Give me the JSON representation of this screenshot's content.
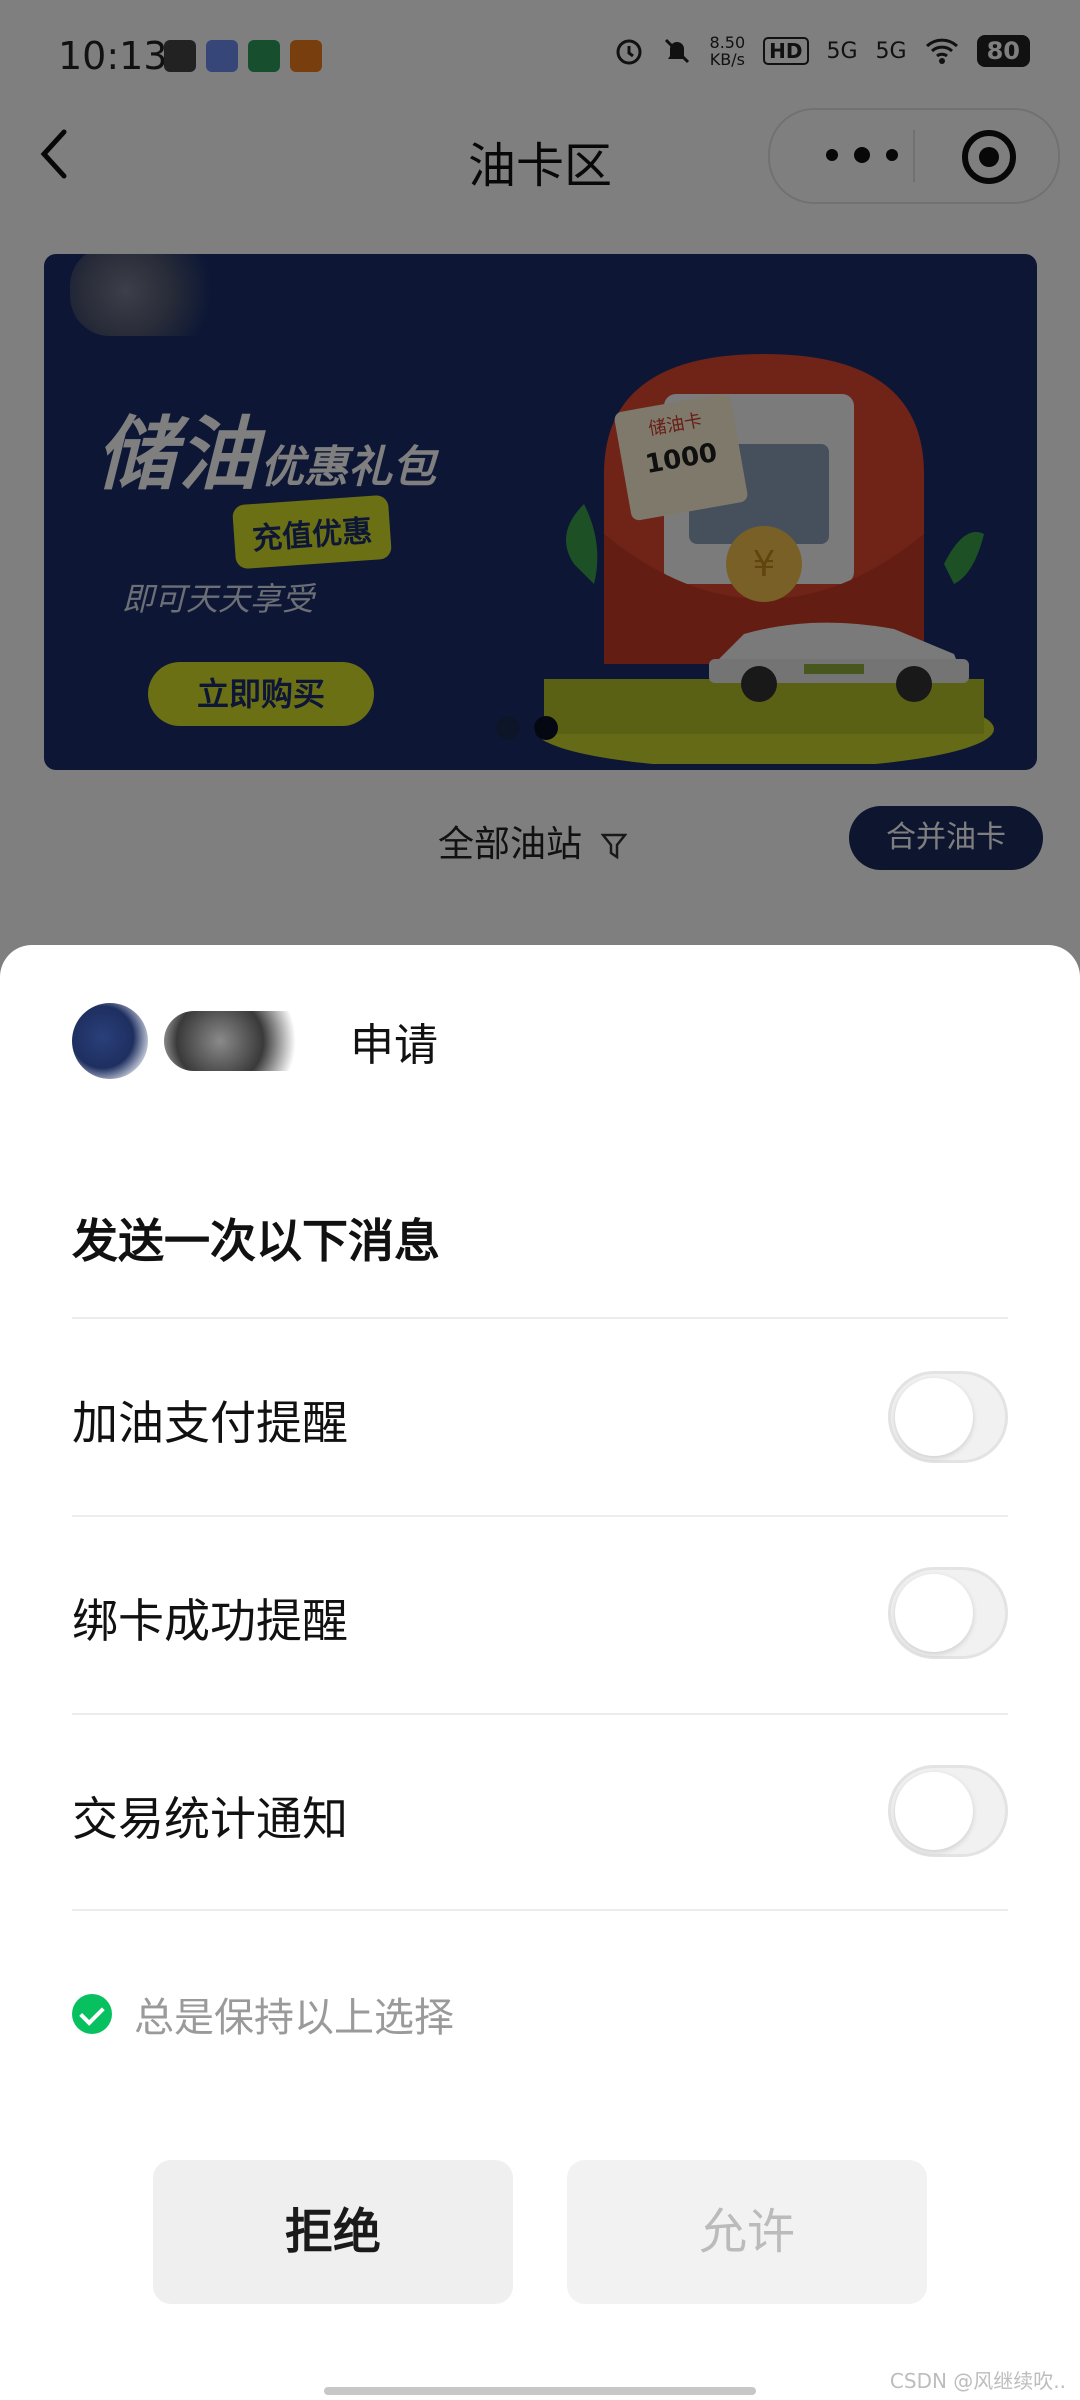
{
  "status_bar": {
    "time": "10:13",
    "net_speed_value": "8.50",
    "net_speed_unit": "KB/s",
    "hd_label": "HD",
    "signal1_label": "5G",
    "signal2_label": "5G",
    "battery": "80"
  },
  "nav": {
    "title": "油卡区"
  },
  "banner": {
    "title_main": "储油",
    "title_small": "优惠礼包",
    "tag": "充值优惠",
    "subtitle": "即可天天享受",
    "button": "立即购买",
    "card_label": "储油卡",
    "card_amount": "1000"
  },
  "filter": {
    "station_filter": "全部油站",
    "merge_button": "合并油卡"
  },
  "sheet": {
    "request_label": "申请",
    "title": "发送一次以下消息",
    "options": [
      {
        "label": "加油支付提醒",
        "enabled": false
      },
      {
        "label": "绑卡成功提醒",
        "enabled": false
      },
      {
        "label": "交易统计通知",
        "enabled": false
      }
    ],
    "keep_choice": "总是保持以上选择",
    "reject": "拒绝",
    "allow": "允许",
    "watermark": "CSDN @风继续吹.."
  },
  "colors": {
    "accent_green": "#07c160",
    "banner_navy": "#1a2f6b",
    "banner_yellow": "#d8e02a"
  }
}
